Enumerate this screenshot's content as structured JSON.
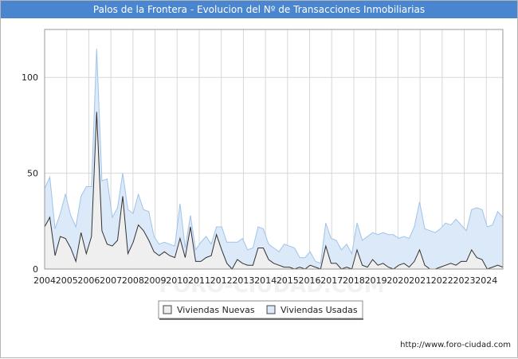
{
  "header": {
    "title": "Palos de la Frontera - Evolucion del Nº de Transacciones Inmobiliarias"
  },
  "footer": {
    "credit": "http://www.foro-ciudad.com"
  },
  "watermark": "FORO-CIUDAD.COM",
  "colors": {
    "title_bg": "#4a86cf",
    "nuevas_fill": "#efefef",
    "nuevas_line": "#333333",
    "usadas_fill": "#dce9f8",
    "usadas_line": "#9ec4ea",
    "grid": "#d7d7d7"
  },
  "chart_data": {
    "type": "area",
    "title": "Palos de la Frontera - Evolucion del Nº de Transacciones Inmobiliarias",
    "xlabel": "",
    "ylabel": "",
    "xlim": [
      2004,
      2024.75
    ],
    "ylim": [
      0,
      125
    ],
    "y_ticks": [
      0,
      50,
      100
    ],
    "x_ticks": [
      "2004",
      "2005",
      "2006",
      "2007",
      "2008",
      "2009",
      "2010",
      "2011",
      "2012",
      "2013",
      "2014",
      "2015",
      "2016",
      "2017",
      "2018",
      "2019",
      "2020",
      "2021",
      "2022",
      "2023",
      "2024"
    ],
    "x_tick_values": [
      2004,
      2005,
      2006,
      2007,
      2008,
      2009,
      2010,
      2011,
      2012,
      2013,
      2014,
      2015,
      2016,
      2017,
      2018,
      2019,
      2020,
      2021,
      2022,
      2023,
      2024
    ],
    "grid": true,
    "legend_position": "bottom-center",
    "stacked": true,
    "quarters_start": 2004,
    "series": [
      {
        "name": "Viviendas Nuevas",
        "values": [
          22,
          27,
          7,
          17,
          16,
          11,
          4,
          19,
          8,
          17,
          82,
          20,
          13,
          12,
          15,
          38,
          8,
          14,
          23,
          20,
          15,
          9,
          7,
          9,
          7,
          6,
          16,
          6,
          22,
          4,
          4,
          6,
          7,
          18,
          10,
          3,
          0,
          5,
          3,
          2,
          2,
          11,
          11,
          5,
          3,
          2,
          1,
          1,
          0,
          1,
          0,
          2,
          1,
          0,
          12,
          3,
          3,
          0,
          1,
          0,
          10,
          2,
          1,
          5,
          2,
          3,
          1,
          0,
          2,
          3,
          1,
          4,
          10,
          2,
          0,
          0,
          1,
          2,
          3,
          2,
          4,
          4,
          10,
          6,
          5,
          0,
          1,
          2,
          1
        ]
      },
      {
        "name": "Viviendas Usadas",
        "values": [
          20,
          21,
          14,
          12,
          23,
          17,
          18,
          19,
          35,
          26,
          33,
          26,
          34,
          15,
          17,
          12,
          23,
          15,
          16,
          11,
          15,
          8,
          6,
          5,
          6,
          6,
          18,
          5,
          6,
          6,
          10,
          11,
          6,
          4,
          12,
          11,
          14,
          9,
          13,
          8,
          9,
          11,
          10,
          8,
          8,
          7,
          12,
          11,
          11,
          5,
          6,
          7,
          3,
          3,
          12,
          13,
          12,
          10,
          12,
          8,
          14,
          13,
          16,
          14,
          16,
          16,
          17,
          18,
          14,
          14,
          15,
          18,
          25,
          19,
          20,
          19,
          20,
          22,
          20,
          24,
          19,
          16,
          21,
          26,
          26,
          22,
          22,
          28,
          26
        ]
      }
    ]
  }
}
